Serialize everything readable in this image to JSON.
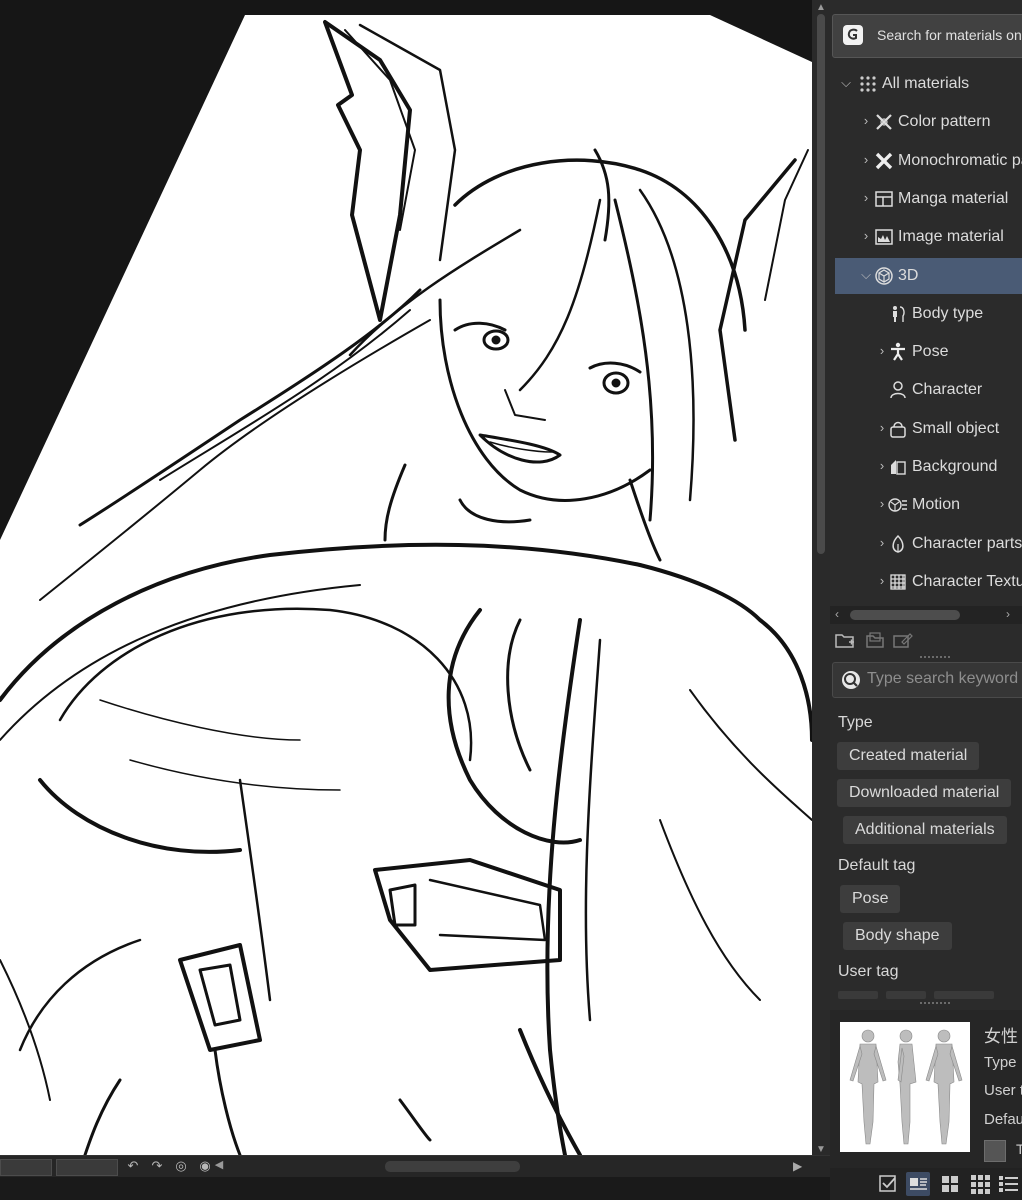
{
  "assets_button": {
    "label": "Search for materials on ASSETS"
  },
  "tree": [
    {
      "label": "All materials",
      "icon": "grid-dots-icon",
      "chevron": "⌵",
      "indent": 0
    },
    {
      "label": "Color pattern",
      "icon": "color-pattern-icon",
      "chevron": "›",
      "indent": 1
    },
    {
      "label": "Monochromatic pattern",
      "icon": "monochromatic-pattern-icon",
      "chevron": "›",
      "indent": 1
    },
    {
      "label": "Manga material",
      "icon": "manga-material-icon",
      "chevron": "›",
      "indent": 1
    },
    {
      "label": "Image material",
      "icon": "image-material-icon",
      "chevron": "›",
      "indent": 1
    },
    {
      "label": "3D",
      "icon": "cube-3d-icon",
      "chevron": "⌵",
      "indent": 1,
      "selected": true
    },
    {
      "label": "Body type",
      "icon": "body-type-icon",
      "chevron": "",
      "indent": 2
    },
    {
      "label": "Pose",
      "icon": "pose-icon",
      "chevron": "›",
      "indent": 2
    },
    {
      "label": "Character",
      "icon": "character-icon",
      "chevron": "",
      "indent": 2
    },
    {
      "label": "Small object",
      "icon": "small-object-icon",
      "chevron": "›",
      "indent": 2
    },
    {
      "label": "Background",
      "icon": "background-icon",
      "chevron": "›",
      "indent": 2
    },
    {
      "label": "Motion",
      "icon": "motion-icon",
      "chevron": "›",
      "indent": 2
    },
    {
      "label": "Character parts",
      "icon": "character-parts-icon",
      "chevron": "›",
      "indent": 2
    },
    {
      "label": "Character Texture",
      "icon": "character-texture-icon",
      "chevron": "›",
      "indent": 2
    }
  ],
  "search": {
    "placeholder": "Type search keyword"
  },
  "filters": {
    "type_heading": "Type",
    "type_chips": [
      "Created material",
      "Downloaded material",
      "Additional materials"
    ],
    "default_tag_heading": "Default tag",
    "default_tag_chips": [
      "Pose",
      "Body shape"
    ],
    "user_tag_heading": "User tag"
  },
  "preview": {
    "name": "女性",
    "lines": [
      "Type",
      "User t",
      "Defau"
    ],
    "checkbox_label": "T"
  },
  "colors": {
    "selection": "#4a5b75",
    "panel": "#2b2b2b"
  }
}
